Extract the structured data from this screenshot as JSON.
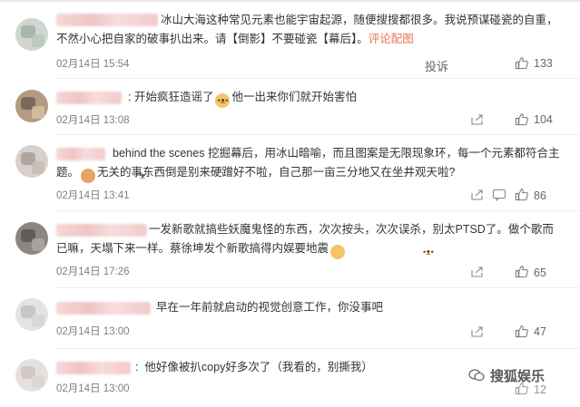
{
  "comments": [
    {
      "text": "冰山大海这种常见元素也能宇宙起源，随便搜搜都很多。我说预谋碰瓷的自重，不然小心把自家的破事扒出来。请【倒影】不要碰瓷【幕后】。",
      "link": "评论配图",
      "time": "02月14日 15:54",
      "report": "投诉",
      "likes": "133"
    },
    {
      "text_a": "开始疯狂造谣了",
      "text_b": "他一出来你们就开始害怕",
      "time": "02月14日 13:08",
      "likes": "104"
    },
    {
      "text_a": "behind the scenes 挖掘幕后，用冰山暗喻，而且图案是无限现象环，每一个元素都符合主题。",
      "text_b": "无关的事东西倒是别来硬蹭好不啦，自己那一亩三分地又在坐井观天啦?",
      "time": "02月14日 13:41",
      "likes": "86"
    },
    {
      "text_a": "一发新歌就搞些妖魔鬼怪的东西，次次按头，次次误杀，别太PTSD了。做个歌而已嘛，天塌下来一样。蔡徐坤发个新歌搞得内娱要地震",
      "time": "02月14日 17:26",
      "likes": "65"
    },
    {
      "text": "早在一年前就启动的视觉创意工作，你没事吧",
      "time": "02月14日 13:00",
      "likes": "47"
    },
    {
      "text": "他好像被扒copy好多次了（我看的，别撕我）",
      "time": "02月14日 13:00",
      "likes": "12"
    }
  ],
  "watermark": "搜狐娱乐",
  "icons": [
    "share-icon",
    "reply-icon",
    "like-icon",
    "dog-emoji",
    "cat-emoji"
  ]
}
